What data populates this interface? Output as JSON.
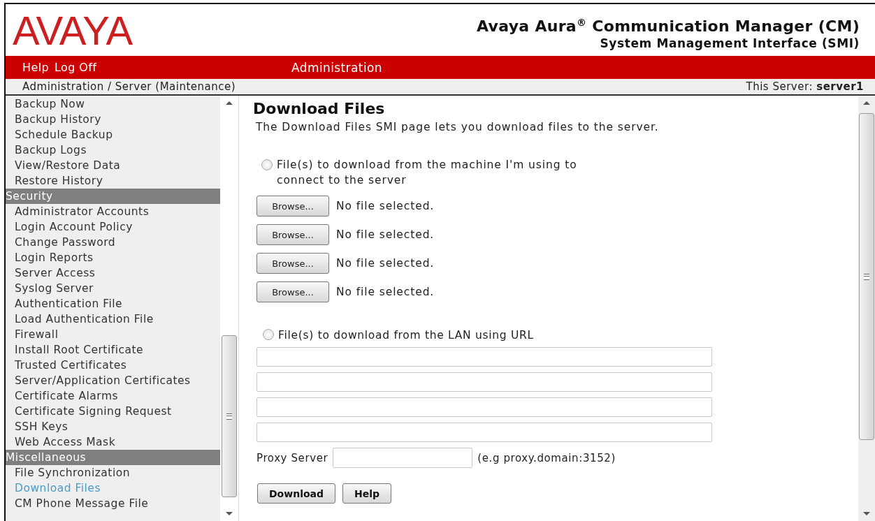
{
  "header": {
    "logo": "AVAYA",
    "title": "Avaya Aura$^{®}$ Communication Manager (CM)",
    "subtitle": "System Management Interface (SMI)"
  },
  "menu_bar": {
    "links": [
      "Help",
      "Log Off"
    ],
    "section": "Administration"
  },
  "breadcrumb": {
    "path": "Administration / Server (Maintenance)",
    "server": "This Server: **server1**"
  },
  "sidebar": {
    "items": [
      {
        "kind": "item",
        "label": "Backup Now",
        "selected": false
      },
      {
        "kind": "item",
        "label": "Backup History",
        "selected": false
      },
      {
        "kind": "item",
        "label": "Schedule Backup",
        "selected": false
      },
      {
        "kind": "item",
        "label": "Backup Logs",
        "selected": false
      },
      {
        "kind": "item",
        "label": "View/Restore Data",
        "selected": false
      },
      {
        "kind": "item",
        "label": "Restore History",
        "selected": false
      },
      {
        "kind": "heading",
        "label": "Security"
      },
      {
        "kind": "item",
        "label": "Administrator Accounts",
        "selected": false
      },
      {
        "kind": "item",
        "label": "Login Account Policy",
        "selected": false
      },
      {
        "kind": "item",
        "label": "Change Password",
        "selected": false
      },
      {
        "kind": "item",
        "label": "Login Reports",
        "selected": false
      },
      {
        "kind": "item",
        "label": "Server Access",
        "selected": false
      },
      {
        "kind": "item",
        "label": "Syslog Server",
        "selected": false
      },
      {
        "kind": "item",
        "label": "Authentication File",
        "selected": false
      },
      {
        "kind": "item",
        "label": "Load Authentication File",
        "selected": false
      },
      {
        "kind": "item",
        "label": "Firewall",
        "selected": false
      },
      {
        "kind": "item",
        "label": "Install Root Certificate",
        "selected": false
      },
      {
        "kind": "item",
        "label": "Trusted Certificates",
        "selected": false
      },
      {
        "kind": "item",
        "label": "Server/Application Certificates",
        "selected": false
      },
      {
        "kind": "item",
        "label": "Certificate Alarms",
        "selected": false
      },
      {
        "kind": "item",
        "label": "Certificate Signing Request",
        "selected": false
      },
      {
        "kind": "item",
        "label": "SSH Keys",
        "selected": false
      },
      {
        "kind": "item",
        "label": "Web Access Mask",
        "selected": false
      },
      {
        "kind": "heading",
        "label": "Miscellaneous"
      },
      {
        "kind": "item",
        "label": "File Synchronization",
        "selected": false
      },
      {
        "kind": "item",
        "label": "Download Files",
        "selected": true
      },
      {
        "kind": "item",
        "label": "CM Phone Message File",
        "selected": false
      }
    ]
  },
  "main": {
    "title": "Download Files",
    "description": "The Download Files SMI page lets you download files to the server.",
    "local_option": {
      "label": "File(s) to download from the machine I'm using to connect to the server",
      "selected": false,
      "files": [
        {
          "button": "Browse...",
          "status": "No file selected."
        },
        {
          "button": "Browse...",
          "status": "No file selected."
        },
        {
          "button": "Browse...",
          "status": "No file selected."
        },
        {
          "button": "Browse...",
          "status": "No file selected."
        }
      ]
    },
    "lan_option": {
      "label": "File(s) to download from the LAN using URL",
      "selected": false
    },
    "proxy": {
      "label": "Proxy Server",
      "hint": "(e.g proxy.domain:3152)"
    },
    "buttons": [
      "Download",
      "Help"
    ]
  }
}
